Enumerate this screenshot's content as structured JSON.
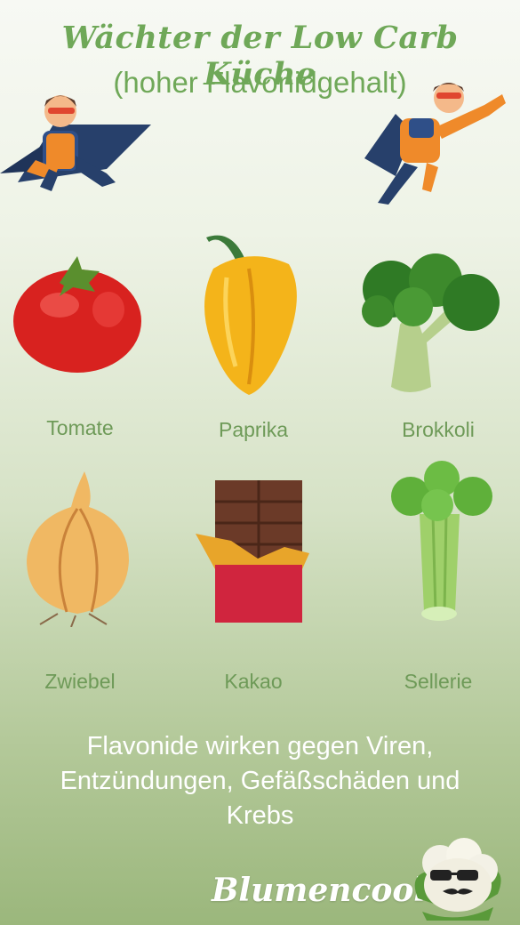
{
  "title": {
    "line1": "Wächter der Low Carb Küche",
    "line2": "(hoher Flavonidgehalt)"
  },
  "items": [
    {
      "label": "Tomate",
      "icon": "tomato-icon"
    },
    {
      "label": "Paprika",
      "icon": "pepper-icon"
    },
    {
      "label": "Brokkoli",
      "icon": "broccoli-icon"
    },
    {
      "label": "Zwiebel",
      "icon": "onion-icon"
    },
    {
      "label": "Kakao",
      "icon": "chocolate-icon"
    },
    {
      "label": "Sellerie",
      "icon": "celery-icon"
    }
  ],
  "footer": {
    "line1": "Flavonide wirken gegen Viren,",
    "line2": "Entzündungen, Gefäßschäden und",
    "line3": "Krebs"
  },
  "brand": "Blumencool.de",
  "colors": {
    "title": "#6fa858",
    "label": "#6e9a58",
    "footer_text": "#ffffff"
  }
}
